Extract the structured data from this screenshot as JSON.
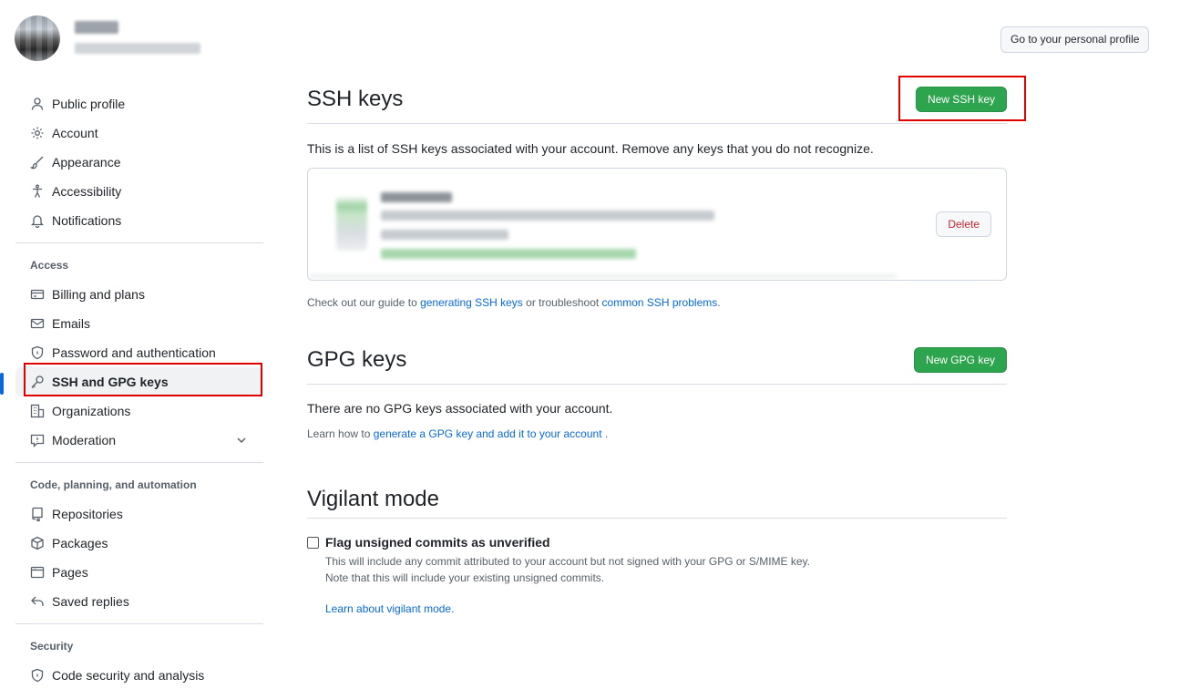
{
  "header": {
    "profile_button": "Go to your personal profile"
  },
  "sidebar": {
    "items": [
      {
        "label": "Public profile"
      },
      {
        "label": "Account"
      },
      {
        "label": "Appearance"
      },
      {
        "label": "Accessibility"
      },
      {
        "label": "Notifications"
      }
    ],
    "access_heading": "Access",
    "access_items": [
      {
        "label": "Billing and plans"
      },
      {
        "label": "Emails"
      },
      {
        "label": "Password and authentication"
      },
      {
        "label": "SSH and GPG keys"
      },
      {
        "label": "Organizations"
      },
      {
        "label": "Moderation"
      }
    ],
    "code_heading": "Code, planning, and automation",
    "code_items": [
      {
        "label": "Repositories"
      },
      {
        "label": "Packages"
      },
      {
        "label": "Pages"
      },
      {
        "label": "Saved replies"
      }
    ],
    "security_heading": "Security",
    "security_items": [
      {
        "label": "Code security and analysis"
      }
    ]
  },
  "ssh": {
    "title": "SSH keys",
    "new_button": "New SSH key",
    "description": "This is a list of SSH keys associated with your account. Remove any keys that you do not recognize.",
    "delete_button": "Delete",
    "help_prefix": "Check out our guide to ",
    "help_link1": "generating SSH keys",
    "help_middle": " or troubleshoot ",
    "help_link2": "common SSH problems",
    "help_suffix": "."
  },
  "gpg": {
    "title": "GPG keys",
    "new_button": "New GPG key",
    "description": "There are no GPG keys associated with your account.",
    "help_prefix": "Learn how to ",
    "help_link": "generate a GPG key and add it to your account",
    "help_suffix": " ."
  },
  "vigilant": {
    "title": "Vigilant mode",
    "checkbox_label": "Flag unsigned commits as unverified",
    "line1": "This will include any commit attributed to your account but not signed with your GPG or S/MIME key.",
    "line2": "Note that this will include your existing unsigned commits.",
    "learn_link": "Learn about vigilant mode."
  },
  "colors": {
    "primary_green": "#2da44e",
    "link_blue": "#0969da",
    "danger_red": "#cf222e",
    "highlight_red": "#e00000"
  }
}
